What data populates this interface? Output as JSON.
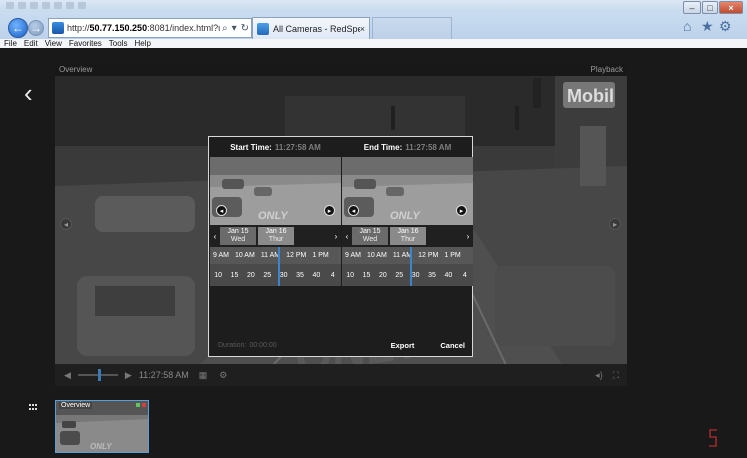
{
  "browser": {
    "url_prefix": "http://",
    "url_host": "50.77.150.250",
    "url_rest": ":8081/index.html?usr=Poice&p",
    "tab_title": "All Cameras - RedSpeed® ...",
    "tab_close": "×",
    "menu": [
      "File",
      "Edit",
      "View",
      "Favorites",
      "Tools",
      "Help"
    ],
    "search_glyph": "⌕",
    "dropdown_glyph": "▾",
    "refresh_glyph": "↻",
    "window_controls": {
      "minimize": "–",
      "maximize": "□",
      "close": "×"
    },
    "icons": [
      "back-icon",
      "forward-icon",
      "home-icon",
      "star-icon",
      "gear-icon"
    ]
  },
  "app": {
    "back_glyph": "‹",
    "video": {
      "panel_title": "Overview",
      "panel_mode": "Playback",
      "store_sign": "Mobil",
      "road_text": "ONLY"
    },
    "controls": {
      "play_back": "◀",
      "play_fwd": "▶",
      "time": "11:27:58 AM",
      "icons": [
        "calendar-icon",
        "settings-icon",
        "volume-icon",
        "fullscreen-icon"
      ]
    },
    "dialog": {
      "start": {
        "label": "Start Time:",
        "time": "11:27:58 AM",
        "dates": [
          {
            "day": "Jan 15",
            "dow": "Wed"
          },
          {
            "day": "Jan 16",
            "dow": "Thur"
          }
        ],
        "hours": [
          "9 AM",
          "10 AM",
          "11 AM",
          "12 PM",
          "1 PM"
        ],
        "minutes": [
          "10",
          "15",
          "20",
          "25",
          "30",
          "35",
          "40",
          "4"
        ]
      },
      "end": {
        "label": "End Time:",
        "time": "11:27:58 AM",
        "dates": [
          {
            "day": "Jan 15",
            "dow": "Wed"
          },
          {
            "day": "Jan 16",
            "dow": "Thur"
          }
        ],
        "hours": [
          "9 AM",
          "10 AM",
          "11 AM",
          "12 PM",
          "1 PM"
        ],
        "minutes": [
          "10",
          "15",
          "20",
          "25",
          "30",
          "35",
          "40",
          "4"
        ]
      },
      "duration_label": "Duration:",
      "duration_value": "00:00:00",
      "export_label": "Export",
      "cancel_label": "Cancel",
      "prev_glyph": "‹",
      "next_glyph": "›",
      "cam_prev_glyph": "◂",
      "cam_next_glyph": "▸"
    },
    "thumbnail": {
      "label": "Overview",
      "road_text": "ONLY"
    },
    "accent": "#3b86c8"
  }
}
